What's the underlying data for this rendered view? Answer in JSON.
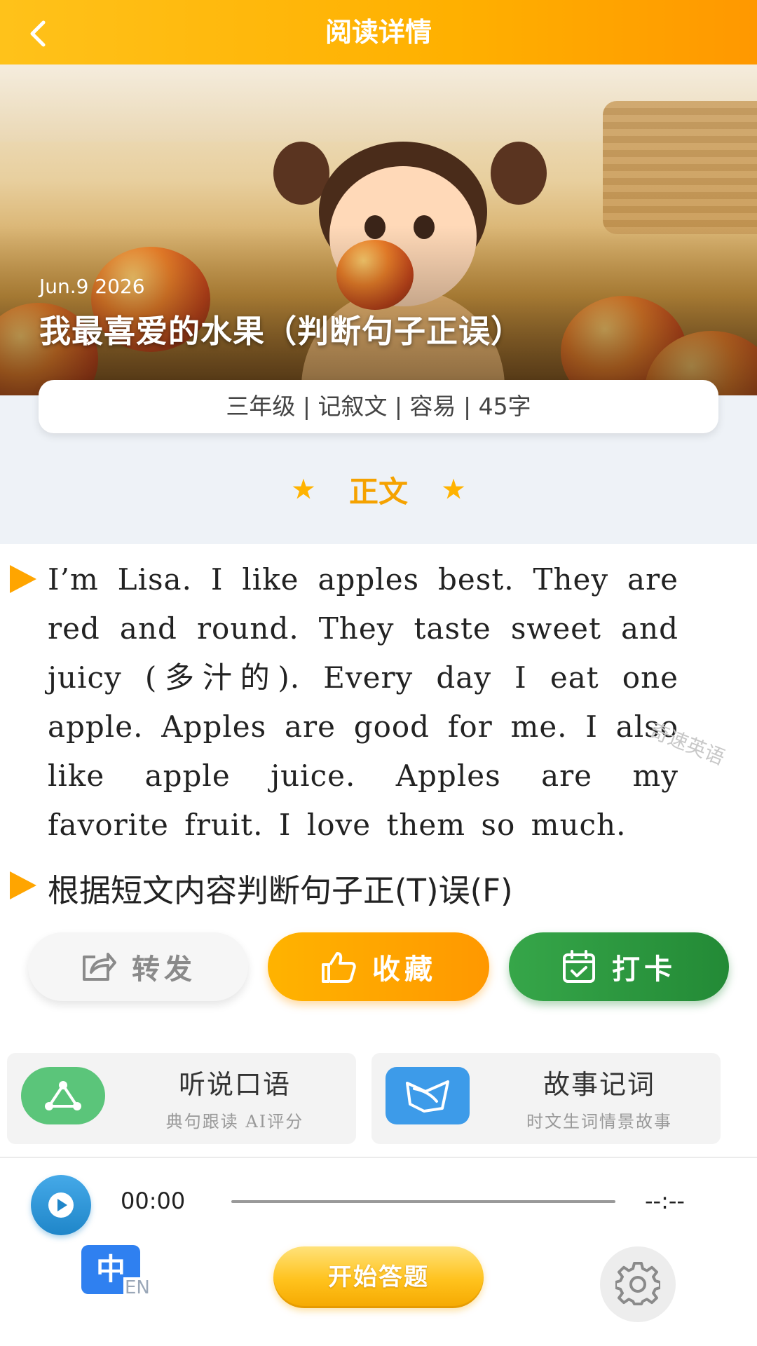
{
  "header": {
    "title": "阅读详情"
  },
  "hero": {
    "date": "Jun.9 2026",
    "title": "我最喜爱的水果（判断句子正误）"
  },
  "info": {
    "text": "三年级 | 记叙文 | 容易 | 45字"
  },
  "section": {
    "star_left": "★",
    "title": "正文",
    "star_right": "★"
  },
  "passage": "I’m Lisa. I like apples best. They are red and round. They taste sweet and juicy (多汁的). Every day I eat one apple. Apples are good for me. I also like apple juice. Apples are my favorite fruit. I love them so much.",
  "watermark": "奇速英语",
  "question": "根据短文内容判断句子正(T)误(F)",
  "actions": {
    "share": "转发",
    "favorite": "收藏",
    "checkin": "打卡"
  },
  "features": [
    {
      "title": "听说口语",
      "subtitle": "典句跟读 AI评分"
    },
    {
      "title": "故事记词",
      "subtitle": "时文生词情景故事"
    }
  ],
  "player": {
    "current_time": "00:00",
    "total_time": "--:--",
    "progress": 0
  },
  "bottom": {
    "lang_zh": "中",
    "lang_en": "EN",
    "start_label": "开始答题"
  },
  "colors": {
    "accent": "#FFB000",
    "green": "#238A36",
    "blue": "#2F80F0"
  }
}
